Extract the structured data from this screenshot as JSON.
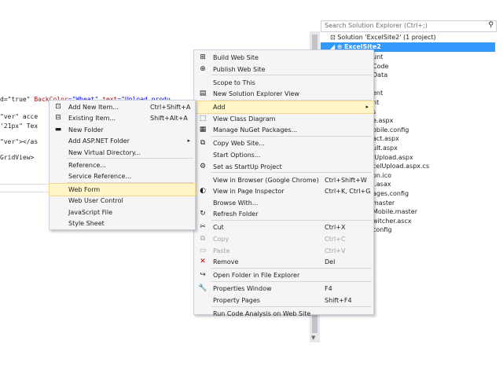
{
  "editor": {
    "lines": [
      {
        "pre": "d=\"true\" ",
        "a": "BackColor",
        "b": "=\"Wheat\" ",
        "c": "text",
        "d": "=\"Upload produ..."
      },
      {
        "pre": "\"ver\" acce",
        "a": "",
        "b": "",
        "c": "",
        "d": ""
      },
      {
        "pre": "'21px\" Tex",
        "a": "",
        "b": "",
        "c": "",
        "d": ""
      },
      {
        "pre": "\"ver\"></as",
        "a": "",
        "b": "",
        "c": "",
        "d": ""
      },
      {
        "pre": "GridView>",
        "a": "",
        "b": "",
        "c": "",
        "d": ""
      }
    ]
  },
  "solution_explorer": {
    "search_placeholder": "Search Solution Explorer (Ctrl+;)",
    "solution_label": "Solution 'ExcelSite2' (1 project)",
    "project_label": "ExcelSite2",
    "items": [
      "unt",
      "Code",
      "Data",
      "",
      "ent",
      "nt",
      "s",
      "e.aspx",
      "obile.config",
      "act.aspx",
      "ult.aspx",
      "lUpload.aspx",
      "celUpload.aspx.cs",
      "on.ico",
      "l.asax",
      "ages.config",
      "master",
      "Mobile.master",
      "witcher.ascx",
      "config"
    ]
  },
  "menu_main": {
    "items": [
      {
        "icon": "⊞",
        "icon_name": "build-icon",
        "label": "Build Web Site",
        "shortcut": "",
        "sep_after": false
      },
      {
        "icon": "⊕",
        "icon_name": "publish-icon",
        "label": "Publish Web Site",
        "shortcut": "",
        "sep_after": true
      },
      {
        "icon": "",
        "icon_name": "",
        "label": "Scope to This",
        "shortcut": "",
        "sep_after": false
      },
      {
        "icon": "▤",
        "icon_name": "new-explorer-view-icon",
        "label": "New Solution Explorer View",
        "shortcut": "",
        "sep_after": true
      },
      {
        "icon": "",
        "icon_name": "",
        "label": "Add",
        "shortcut": "",
        "submenu": true,
        "highlight": true,
        "sep_after": false
      },
      {
        "icon": "⬚",
        "icon_name": "class-diagram-icon",
        "label": "View Class Diagram",
        "shortcut": "",
        "sep_after": false
      },
      {
        "icon": "▦",
        "icon_name": "nuget-icon",
        "label": "Manage NuGet Packages...",
        "shortcut": "",
        "sep_after": true
      },
      {
        "icon": "⧉",
        "icon_name": "copy-web-site-icon",
        "label": "Copy Web Site...",
        "shortcut": "",
        "sep_after": false
      },
      {
        "icon": "",
        "icon_name": "",
        "label": "Start Options...",
        "shortcut": "",
        "sep_after": false
      },
      {
        "icon": "⚙",
        "icon_name": "startup-gear-icon",
        "label": "Set as StartUp Project",
        "shortcut": "",
        "sep_after": true
      },
      {
        "icon": "",
        "icon_name": "",
        "label": "View in Browser (Google Chrome)",
        "shortcut": "Ctrl+Shift+W",
        "sep_after": false
      },
      {
        "icon": "◐",
        "icon_name": "page-inspector-icon",
        "label": "View in Page Inspector",
        "shortcut": "Ctrl+K, Ctrl+G",
        "sep_after": false
      },
      {
        "icon": "",
        "icon_name": "",
        "label": "Browse With...",
        "shortcut": "",
        "sep_after": false
      },
      {
        "icon": "↻",
        "icon_name": "refresh-icon",
        "label": "Refresh Folder",
        "shortcut": "",
        "sep_after": true
      },
      {
        "icon": "✂",
        "icon_name": "cut-icon",
        "label": "Cut",
        "shortcut": "Ctrl+X",
        "sep_after": false
      },
      {
        "icon": "⧉",
        "icon_name": "copy-icon",
        "label": "Copy",
        "shortcut": "Ctrl+C",
        "disabled": true,
        "sep_after": false
      },
      {
        "icon": "▭",
        "icon_name": "paste-icon",
        "label": "Paste",
        "shortcut": "Ctrl+V",
        "disabled": true,
        "sep_after": false
      },
      {
        "icon": "✕",
        "icon_name": "remove-icon",
        "label": "Remove",
        "shortcut": "Del",
        "red": true,
        "sep_after": true
      },
      {
        "icon": "↪",
        "icon_name": "open-folder-icon",
        "label": "Open Folder in File Explorer",
        "shortcut": "",
        "sep_after": true
      },
      {
        "icon": "🔧",
        "icon_name": "properties-wrench-icon",
        "label": "Properties Window",
        "shortcut": "F4",
        "sep_after": false
      },
      {
        "icon": "",
        "icon_name": "",
        "label": "Property Pages",
        "shortcut": "Shift+F4",
        "sep_after": true
      },
      {
        "icon": "",
        "icon_name": "",
        "label": "Run Code Analysis on Web Site",
        "shortcut": "",
        "sep_after": false
      }
    ]
  },
  "menu_add": {
    "items": [
      {
        "icon": "⊡",
        "icon_name": "new-item-icon",
        "label": "Add New Item...",
        "shortcut": "Ctrl+Shift+A",
        "sep_after": false
      },
      {
        "icon": "⊟",
        "icon_name": "existing-item-icon",
        "label": "Existing Item...",
        "shortcut": "Shift+Alt+A",
        "sep_after": false
      },
      {
        "icon": "▬",
        "icon_name": "new-folder-icon",
        "label": "New Folder",
        "shortcut": "",
        "sep_after": false
      },
      {
        "icon": "",
        "icon_name": "",
        "label": "Add ASP.NET Folder",
        "shortcut": "",
        "submenu": true,
        "sep_after": false
      },
      {
        "icon": "",
        "icon_name": "",
        "label": "New Virtual Directory...",
        "shortcut": "",
        "sep_after": true
      },
      {
        "icon": "",
        "icon_name": "",
        "label": "Reference...",
        "shortcut": "",
        "sep_after": false
      },
      {
        "icon": "",
        "icon_name": "",
        "label": "Service Reference...",
        "shortcut": "",
        "sep_after": true
      },
      {
        "icon": "",
        "icon_name": "",
        "label": "Web Form",
        "shortcut": "",
        "highlight": true,
        "sep_after": false
      },
      {
        "icon": "",
        "icon_name": "",
        "label": "Web User Control",
        "shortcut": "",
        "sep_after": false
      },
      {
        "icon": "",
        "icon_name": "",
        "label": "JavaScript File",
        "shortcut": "",
        "sep_after": false
      },
      {
        "icon": "",
        "icon_name": "",
        "label": "Style Sheet",
        "shortcut": "",
        "sep_after": false
      }
    ]
  }
}
